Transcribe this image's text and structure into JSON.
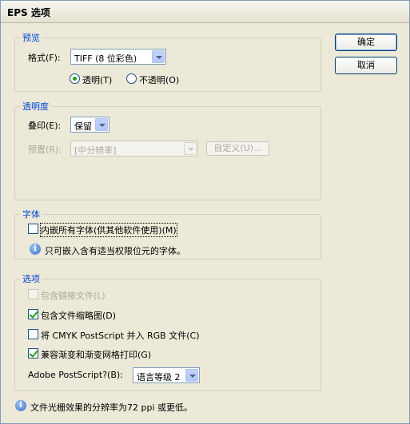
{
  "window": {
    "title": "EPS 选项"
  },
  "buttons": {
    "ok": "确定",
    "cancel": "取消"
  },
  "preview": {
    "legend": "预览",
    "format_label": "格式(F):",
    "format_value": "TIFF (8 位彩色)",
    "transparent_label": "透明(T)",
    "opaque_label": "不透明(O)",
    "selected": "transparent"
  },
  "transparency": {
    "legend": "透明度",
    "overprint_label": "叠印(E):",
    "overprint_value": "保留",
    "preset_label": "预置(R):",
    "preset_value": "[中分辨率]",
    "custom_button": "自定义(U)..."
  },
  "fonts": {
    "legend": "字体",
    "embed_all_label": "内嵌所有字体(供其他软件使用)(M)",
    "embed_all_checked": false,
    "info_text": "只可嵌入含有适当权限位元的字体。"
  },
  "options": {
    "legend": "选项",
    "include_linked_label": "包含链接文件(L)",
    "include_linked_checked": false,
    "include_linked_enabled": false,
    "include_thumbnails_label": "包含文件缩略图(D)",
    "include_thumbnails_checked": true,
    "cmyk_label": "将 CMYK PostScript 并入 RGB 文件(C)",
    "cmyk_checked": false,
    "gradient_label": "兼容渐变和渐变网格打印(G)",
    "gradient_checked": true,
    "postscript_label": "Adobe PostScript?(B):",
    "postscript_value": "语言等级 2"
  },
  "footer": {
    "info_text": "文件光栅效果的分辨率为72 ppi 或更低。"
  },
  "icons": {
    "info": "info-icon",
    "dropdown": "chevron-down-icon"
  }
}
